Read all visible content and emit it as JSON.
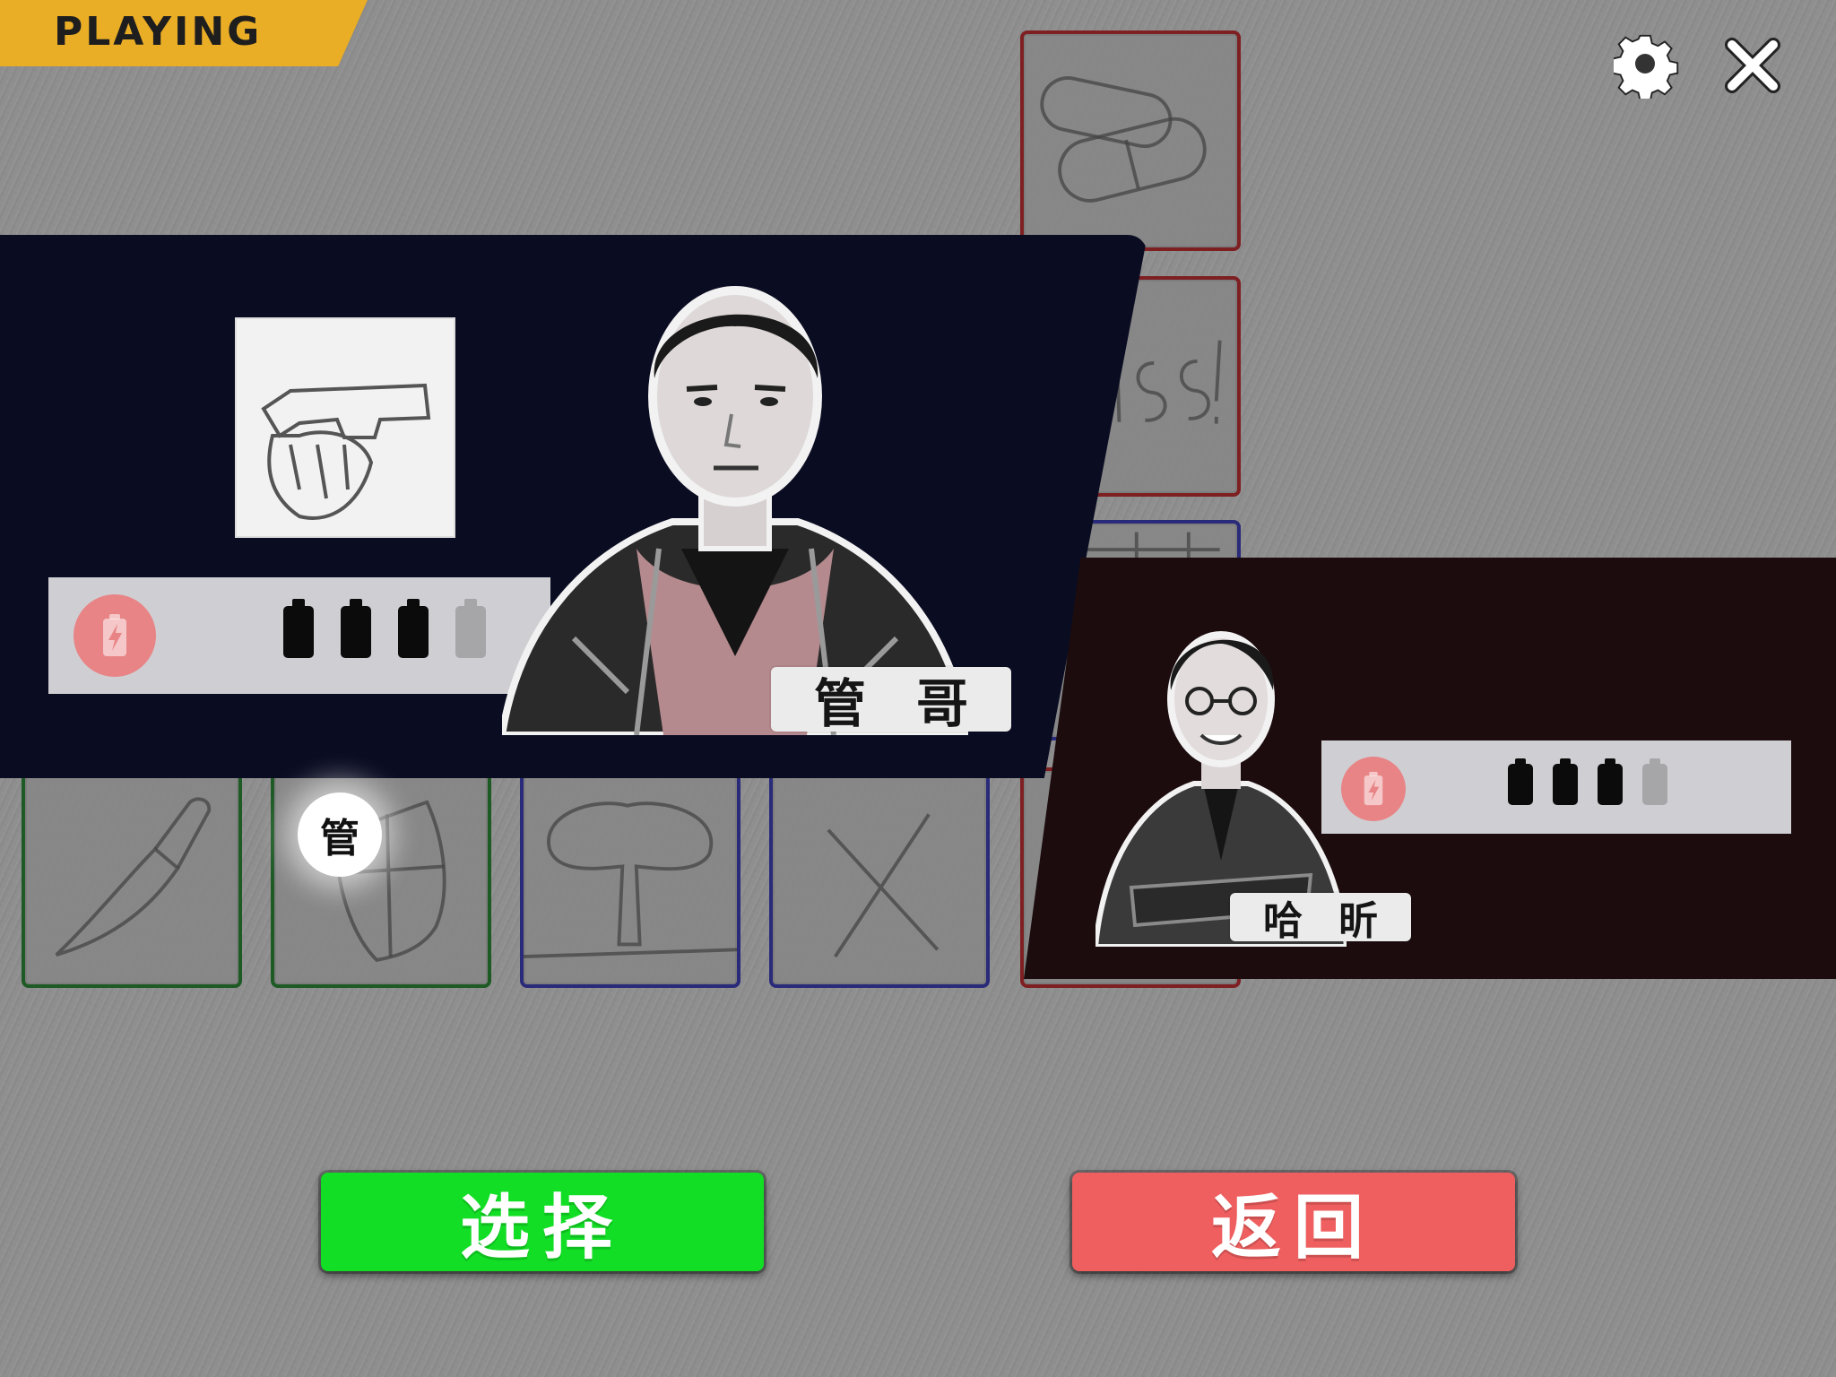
{
  "status": {
    "label": "PLAYING",
    "color": "#e9ad26"
  },
  "toolbar": {
    "settings_icon": "gear-icon",
    "close_icon": "close-icon"
  },
  "cards": {
    "column": [
      {
        "name": "pills",
        "icon": "pills-icon",
        "border": "#7e1f22"
      },
      {
        "name": "miss",
        "icon": "miss-text-icon",
        "border": "#7e1f22"
      },
      {
        "name": "grid",
        "icon": "grid-icon",
        "border": "#2a2a7a"
      }
    ],
    "row": [
      {
        "name": "knife",
        "icon": "knife-icon",
        "border": "#1d5a24"
      },
      {
        "name": "shield",
        "icon": "shield-icon",
        "border": "#1d5a24"
      },
      {
        "name": "explosion",
        "icon": "explosion-icon",
        "border": "#2a2a7a"
      },
      {
        "name": "cross",
        "icon": "cross-icon",
        "border": "#2a2a7a"
      },
      {
        "name": "hidden",
        "icon": "unknown-icon",
        "border": "#7e1f22"
      }
    ]
  },
  "player1": {
    "name": "管哥",
    "name_chars": [
      "管",
      "哥"
    ],
    "weapon": "pistol-icon",
    "energy": {
      "filled": 3,
      "total": 4
    },
    "panel_color": "#0a0c22"
  },
  "player2": {
    "name": "哈昕",
    "name_chars": [
      "哈",
      "昕"
    ],
    "energy": {
      "filled": 3,
      "total": 4
    },
    "panel_color": "#1c0c0d"
  },
  "selection": {
    "badge": "管"
  },
  "actions": {
    "select_label": "选择",
    "back_label": "返回"
  }
}
